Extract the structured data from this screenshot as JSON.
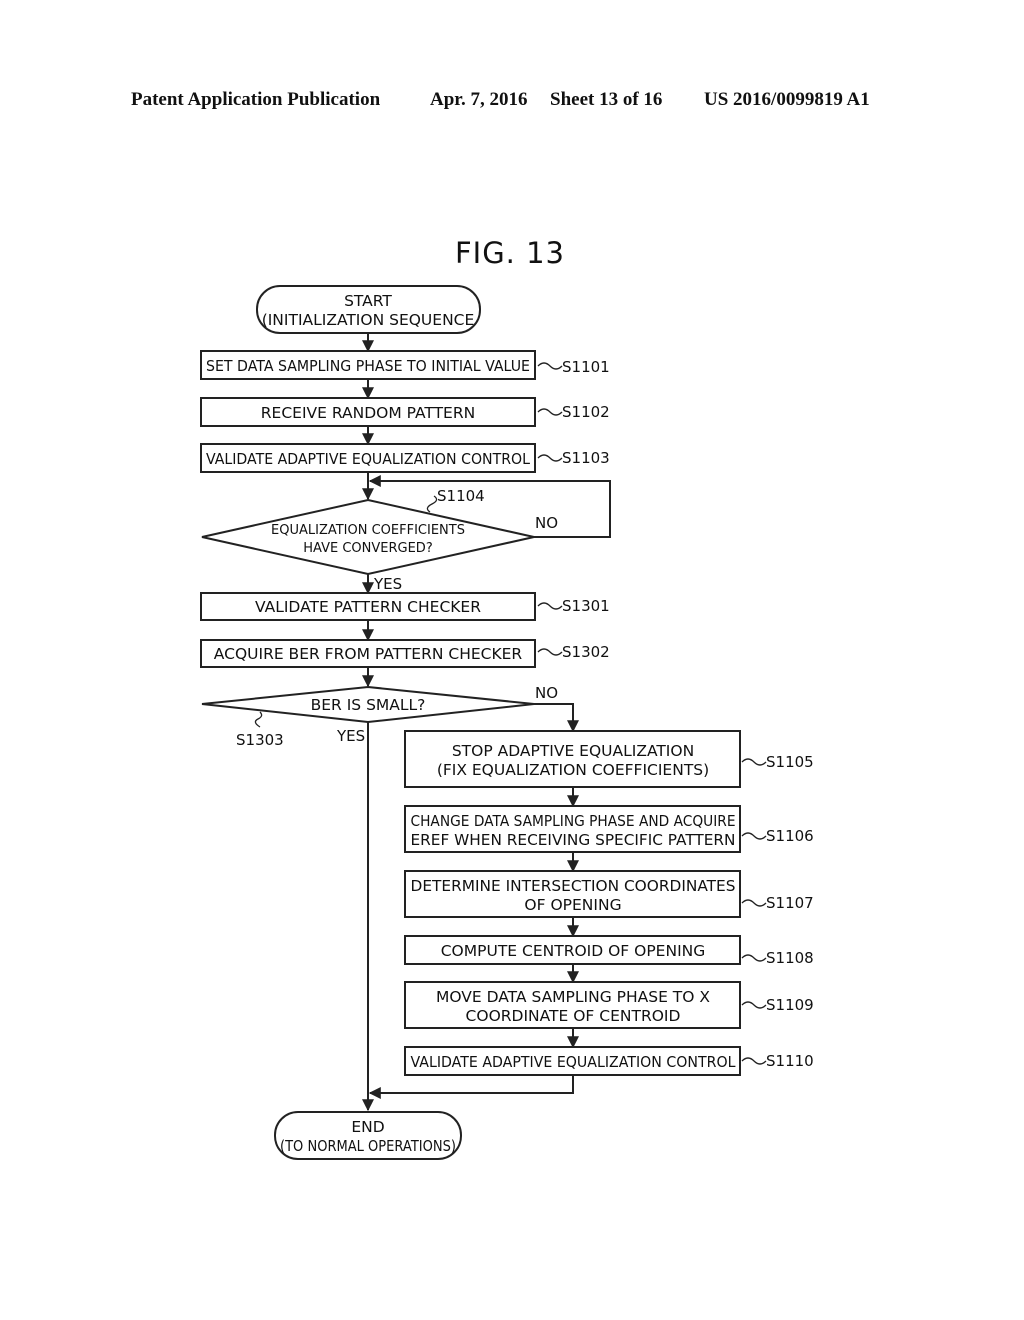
{
  "header": {
    "publication": "Patent Application Publication",
    "date": "Apr. 7, 2016",
    "sheet": "Sheet 13 of 16",
    "number": "US 2016/0099819 A1"
  },
  "figure": {
    "title": "FIG. 13"
  },
  "flowchart": {
    "start": {
      "line1": "START",
      "line2": "(INITIALIZATION SEQUENCE"
    },
    "steps": {
      "s1101": {
        "id": "S1101",
        "text": "SET DATA SAMPLING PHASE TO INITIAL VALUE"
      },
      "s1102": {
        "id": "S1102",
        "text": "RECEIVE RANDOM PATTERN"
      },
      "s1103": {
        "id": "S1103",
        "text": "VALIDATE ADAPTIVE EQUALIZATION CONTROL"
      },
      "s1104": {
        "id": "S1104",
        "line1": "EQUALIZATION COEFFICIENTS",
        "line2": "HAVE CONVERGED?",
        "no": "NO",
        "yes": "YES"
      },
      "s1301": {
        "id": "S1301",
        "text": "VALIDATE PATTERN CHECKER"
      },
      "s1302": {
        "id": "S1302",
        "text": "ACQUIRE BER FROM PATTERN CHECKER"
      },
      "s1303": {
        "id": "S1303",
        "text": "BER IS SMALL?",
        "no": "NO",
        "yes": "YES"
      },
      "s1105": {
        "id": "S1105",
        "line1": "STOP ADAPTIVE EQUALIZATION",
        "line2": "(FIX EQUALIZATION COEFFICIENTS)"
      },
      "s1106": {
        "id": "S1106",
        "line1": "CHANGE DATA SAMPLING PHASE AND ACQUIRE",
        "line2": "EREF WHEN RECEIVING SPECIFIC PATTERN"
      },
      "s1107": {
        "id": "S1107",
        "line1": "DETERMINE INTERSECTION COORDINATES",
        "line2": "OF OPENING"
      },
      "s1108": {
        "id": "S1108",
        "text": "COMPUTE CENTROID OF OPENING"
      },
      "s1109": {
        "id": "S1109",
        "line1": "MOVE DATA SAMPLING PHASE TO X",
        "line2": "COORDINATE OF CENTROID"
      },
      "s1110": {
        "id": "S1110",
        "text": "VALIDATE ADAPTIVE EQUALIZATION CONTROL"
      }
    },
    "end": {
      "line1": "END",
      "line2": "(TO NORMAL OPERATIONS)"
    }
  }
}
